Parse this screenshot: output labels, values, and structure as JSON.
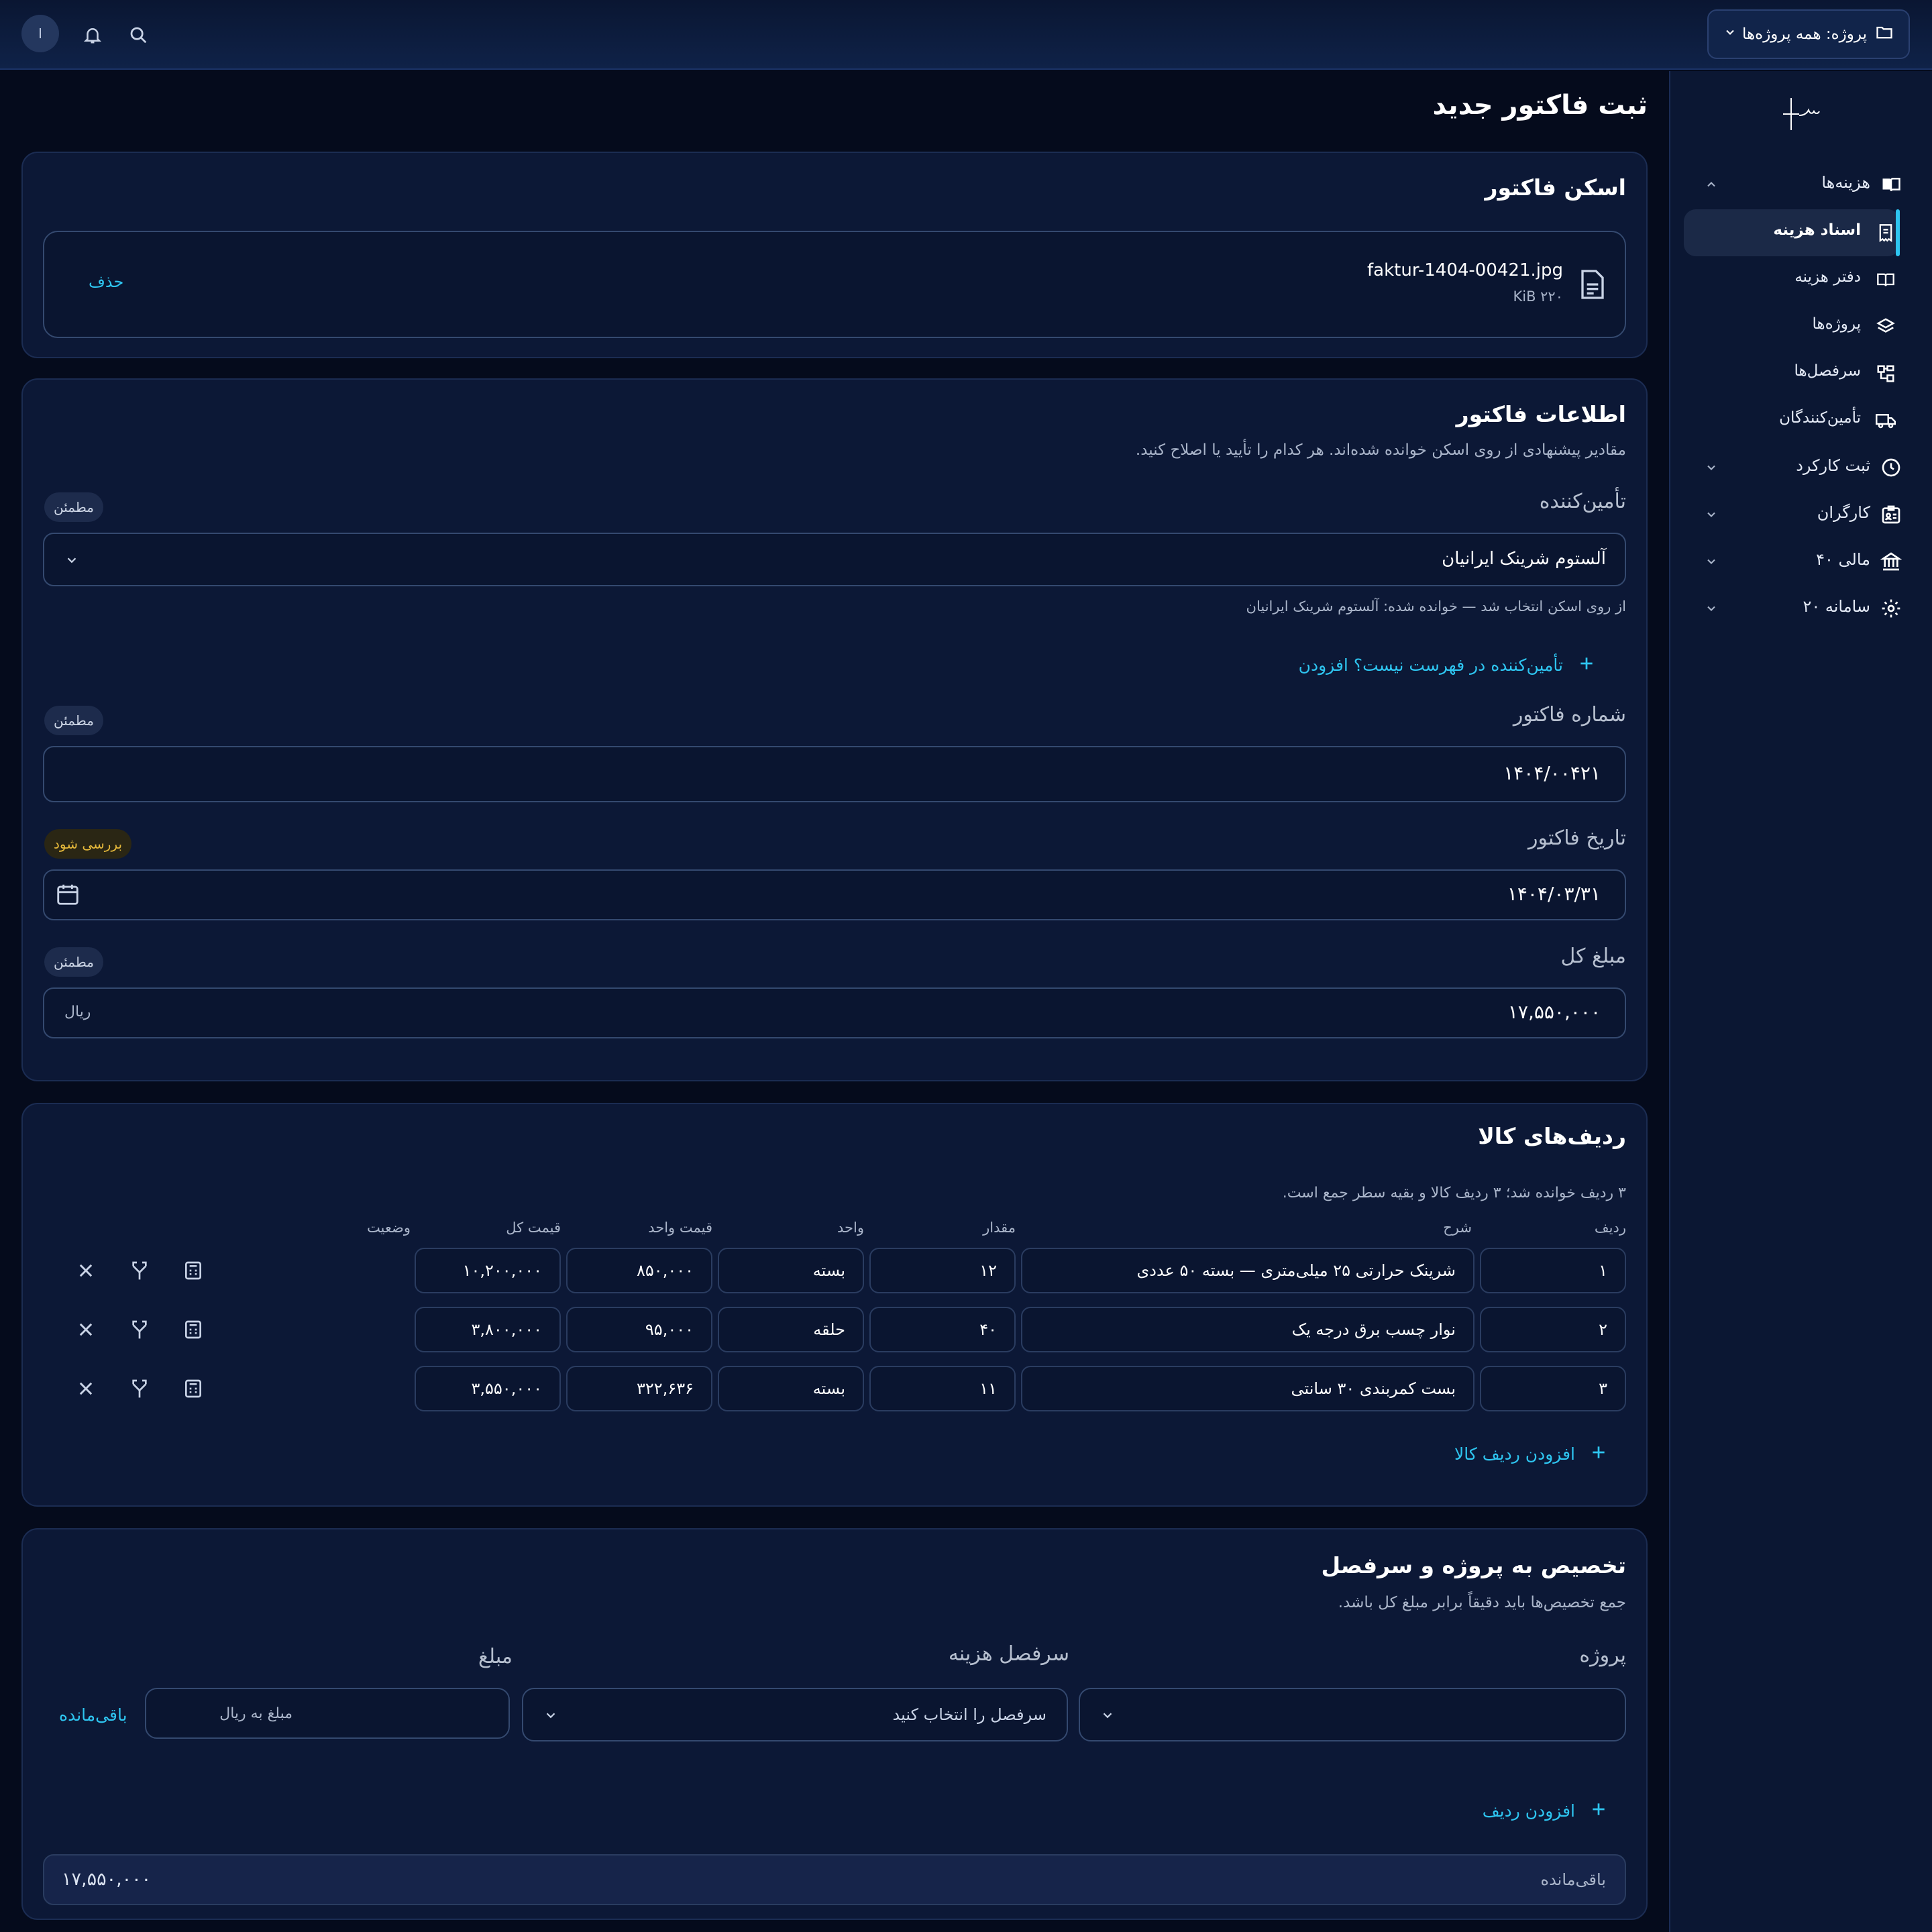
{
  "topbar": {
    "project_label": "پروژه: همه پروژه‌ها",
    "avatar_initial": "ا"
  },
  "sidebar": {
    "items": [
      {
        "label": "هزینه‌ها"
      },
      {
        "label": "اسناد هزینه"
      },
      {
        "label": "دفتر هزینه"
      },
      {
        "label": "پروژه‌ها"
      },
      {
        "label": "سرفصل‌ها"
      },
      {
        "label": "تأمین‌کنندگان"
      },
      {
        "label": "ثبت کارکرد"
      },
      {
        "label": "کارگران"
      },
      {
        "label": "مالی ۴۰"
      },
      {
        "label": "سامانه ۲۰"
      }
    ]
  },
  "page": {
    "title": "ثبت فاکتور جدید"
  },
  "scan": {
    "title": "اسکن فاکتور",
    "file_name": "faktur-1404-00421.jpg",
    "file_size": "KiB ۲۲۰",
    "delete_label": "حذف"
  },
  "info": {
    "title": "اطلاعات فاکتور",
    "subtitle": "مقادیر پیشنهادی از روی اسکن خوانده شده‌اند. هر کدام را تأیید یا اصلاح کنید.",
    "supplier_label": "تأمین‌کننده",
    "supplier_badge": "مطمئن",
    "supplier_value": "آلستوم شرینک ایرانیان",
    "supplier_hint": "از روی اسکن انتخاب شد — خوانده شده: آلستوم شرینک ایرانیان",
    "add_supplier_label": "تأمین‌کننده در فهرست نیست؟ افزودن",
    "invoice_no_label": "شماره فاکتور",
    "invoice_no_badge": "مطمئن",
    "invoice_no_value": "۱۴۰۴/۰۰۴۲۱",
    "date_label": "تاریخ فاکتور",
    "date_badge": "بررسی شود",
    "date_value": "۱۴۰۴/۰۳/۳۱",
    "total_label": "مبلغ کل",
    "total_badge": "مطمئن",
    "total_value": "۱۷,۵۵۰,۰۰۰",
    "total_unit": "ریال"
  },
  "items": {
    "title": "ردیف‌های کالا",
    "subtitle": "۳ ردیف خوانده شد؛ ۳ ردیف کالا و بقیه سطر جمع است.",
    "headers": {
      "row": "ردیف",
      "desc": "شرح",
      "qty": "مقدار",
      "unit": "واحد",
      "unit_price": "قیمت واحد",
      "total": "قیمت کل",
      "status": "وضعیت"
    },
    "rows": [
      {
        "row": "۱",
        "desc": "شرینک حرارتی ۲۵ میلی‌متری — بسته ۵۰ عددی",
        "qty": "۱۲",
        "unit": "بسته",
        "unit_price": "۸۵۰,۰۰۰",
        "total": "۱۰,۲۰۰,۰۰۰"
      },
      {
        "row": "۲",
        "desc": "نوار چسب برق درجه یک",
        "qty": "۴۰",
        "unit": "حلقه",
        "unit_price": "۹۵,۰۰۰",
        "total": "۳,۸۰۰,۰۰۰"
      },
      {
        "row": "۳",
        "desc": "بست کمربندی ۳۰ سانتی",
        "qty": "۱۱",
        "unit": "بسته",
        "unit_price": "۳۲۲,۶۳۶",
        "total": "۳,۵۵۰,۰۰۰"
      }
    ],
    "add_label": "افزودن ردیف کالا"
  },
  "alloc": {
    "title": "تخصیص به پروژه و سرفصل",
    "subtitle": "جمع تخصیص‌ها باید دقیقاً برابر مبلغ کل باشد.",
    "project_label": "پروژه",
    "category_label": "سرفصل هزینه",
    "amount_label": "مبلغ",
    "category_placeholder": "سرفصل را انتخاب کنید",
    "amount_placeholder": "مبلغ به ریال",
    "remaining_link": "باقی‌مانده",
    "add_label": "افزودن ردیف",
    "remaining_label": "باقی‌مانده",
    "remaining_value": "۱۷,۵۵۰,۰۰۰"
  }
}
